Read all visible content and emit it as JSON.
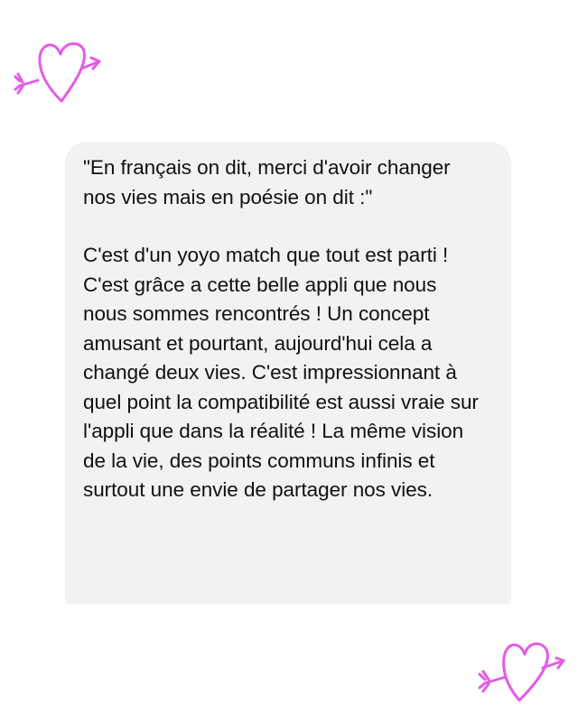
{
  "message": {
    "paragraphs": [
      "\"En français on dit, merci d'avoir changer nos vies mais en poésie on dit :\"",
      "C'est d'un yoyo match que tout est parti ! C'est grâce a cette belle appli que nous nous sommes rencontrés ! Un concept amusant et pourtant, aujourd'hui cela a changé deux vies. C'est impressionnant à quel point la compatibilité est aussi vraie sur l'appli que dans la réalité ! La même vision de la vie, des points communs infinis et surtout une envie de partager nos vies."
    ],
    "bubble_color": "#f2f2f4",
    "text_color": "#111111"
  },
  "decorations": {
    "icon": "heart-arrow-icon",
    "color": "#e35be6"
  }
}
